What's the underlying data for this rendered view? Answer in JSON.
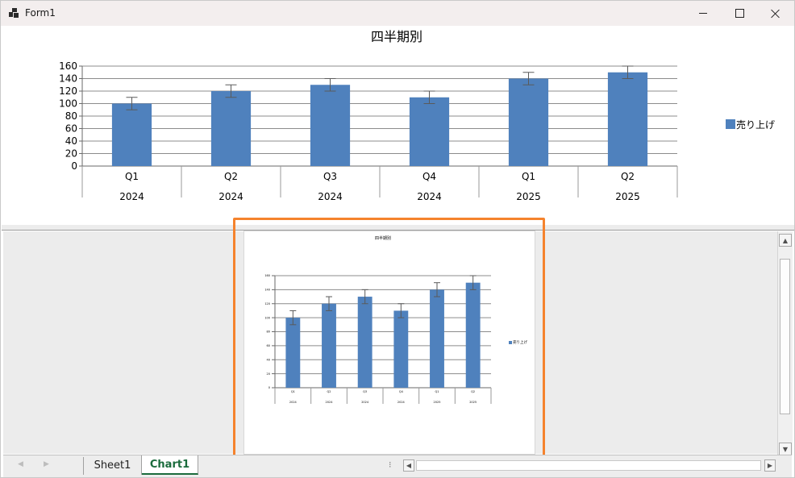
{
  "window": {
    "title": "Form1"
  },
  "chart_data": [
    {
      "type": "bar",
      "title": "四半期別",
      "categories": [
        "Q1",
        "Q2",
        "Q3",
        "Q4",
        "Q1",
        "Q2"
      ],
      "groups": [
        "2024",
        "2024",
        "2024",
        "2024",
        "2025",
        "2025"
      ],
      "series": [
        {
          "name": "売り上げ",
          "values": [
            100,
            120,
            130,
            110,
            140,
            150
          ],
          "error": 10,
          "color": "#4f81bd"
        }
      ],
      "yticks": [
        0,
        20,
        40,
        60,
        80,
        100,
        120,
        140,
        160
      ],
      "ylim": [
        0,
        160
      ],
      "legend": "right",
      "grid": true
    },
    {
      "type": "bar",
      "title": "四半期別",
      "categories": [
        "Q1",
        "Q2",
        "Q3",
        "Q4",
        "Q1",
        "Q2"
      ],
      "groups": [
        "2024",
        "2024",
        "2024",
        "2024",
        "2025",
        "2025"
      ],
      "series": [
        {
          "name": "売り上げ",
          "values": [
            100,
            120,
            130,
            110,
            140,
            150
          ],
          "error": 10,
          "color": "#4f81bd"
        }
      ],
      "yticks": [
        0,
        20,
        40,
        60,
        80,
        100,
        120,
        140,
        160
      ],
      "ylim": [
        0,
        160
      ],
      "legend": "right",
      "grid": true
    }
  ],
  "tabs": [
    {
      "label": "Sheet1",
      "active": false
    },
    {
      "label": "Chart1",
      "active": true
    }
  ],
  "colors": {
    "accent_tab": "#1a6b3c",
    "highlight": "#f5832d",
    "bar": "#4f81bd"
  }
}
